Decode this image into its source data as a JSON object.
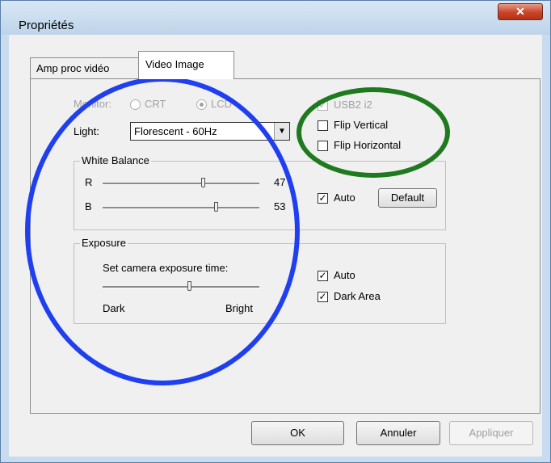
{
  "window": {
    "title": "Propriétés"
  },
  "tabs": [
    {
      "label": "Amp proc vidéo"
    },
    {
      "label": "Video Image"
    }
  ],
  "monitor": {
    "label": "Monitor:",
    "options": [
      "CRT",
      "LCD"
    ],
    "selected": "LCD"
  },
  "light": {
    "label": "Light:",
    "value": "Florescent - 60Hz"
  },
  "usb": {
    "label": "USB2 i2",
    "checked": true
  },
  "flip_vertical": {
    "label": "Flip Vertical",
    "checked": false
  },
  "flip_horizontal": {
    "label": "Flip Horizontal",
    "checked": false
  },
  "white_balance": {
    "title": "White Balance",
    "r": {
      "label": "R",
      "value": "47",
      "fraction": 0.64
    },
    "b": {
      "label": "B",
      "value": "53",
      "fraction": 0.72
    },
    "auto": {
      "label": "Auto",
      "checked": true
    },
    "default_button": "Default"
  },
  "exposure": {
    "title": "Exposure",
    "caption": "Set camera exposure time:",
    "fraction": 0.55,
    "dark_label": "Dark",
    "bright_label": "Bright",
    "auto": {
      "label": "Auto",
      "checked": true
    },
    "dark_area": {
      "label": "Dark Area",
      "checked": true
    }
  },
  "footer": {
    "ok": "OK",
    "cancel": "Annuler",
    "apply": "Appliquer"
  },
  "annotations": {
    "blue_circle_color": "#1f3ff0",
    "green_circle_color": "#1f7a1f"
  }
}
